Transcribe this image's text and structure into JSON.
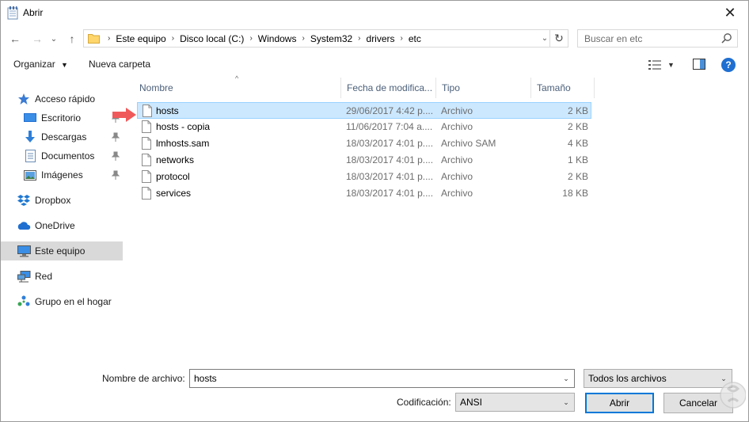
{
  "window": {
    "title": "Abrir",
    "close_glyph": "✕"
  },
  "nav": {
    "back_glyph": "←",
    "forward_glyph": "→",
    "recent_glyph": "⌄",
    "up_glyph": "↑",
    "breadcrumbs": [
      "Este equipo",
      "Disco local (C:)",
      "Windows",
      "System32",
      "drivers",
      "etc"
    ],
    "separator": "›",
    "refresh_glyph": "↻",
    "search_placeholder": "Buscar en etc"
  },
  "commandbar": {
    "organize_label": "Organizar",
    "new_folder_label": "Nueva carpeta",
    "help_glyph": "?"
  },
  "sidebar": {
    "items": [
      {
        "label": "Acceso rápido",
        "icon": "star-icon",
        "pinned": false
      },
      {
        "label": "Escritorio",
        "icon": "desktop-icon",
        "pinned": true
      },
      {
        "label": "Descargas",
        "icon": "download-icon",
        "pinned": true
      },
      {
        "label": "Documentos",
        "icon": "documents-icon",
        "pinned": true
      },
      {
        "label": "Imágenes",
        "icon": "pictures-icon",
        "pinned": true
      },
      {
        "label": "Dropbox",
        "icon": "dropbox-icon",
        "pinned": false
      },
      {
        "label": "OneDrive",
        "icon": "onedrive-icon",
        "pinned": false
      },
      {
        "label": "Este equipo",
        "icon": "computer-icon",
        "pinned": false,
        "selected": true
      },
      {
        "label": "Red",
        "icon": "network-icon",
        "pinned": false
      },
      {
        "label": "Grupo en el hogar",
        "icon": "homegroup-icon",
        "pinned": false
      }
    ]
  },
  "filelist": {
    "columns": [
      "Nombre",
      "Fecha de modifica...",
      "Tipo",
      "Tamaño"
    ],
    "sort_glyph": "^",
    "rows": [
      {
        "name": "hosts",
        "date": "29/06/2017 4:42 p....",
        "type": "Archivo",
        "size": "2 KB",
        "selected": true
      },
      {
        "name": "hosts - copia",
        "date": "11/06/2017 7:04 a....",
        "type": "Archivo",
        "size": "2 KB"
      },
      {
        "name": "lmhosts.sam",
        "date": "18/03/2017 4:01 p....",
        "type": "Archivo SAM",
        "size": "4 KB"
      },
      {
        "name": "networks",
        "date": "18/03/2017 4:01 p....",
        "type": "Archivo",
        "size": "1 KB"
      },
      {
        "name": "protocol",
        "date": "18/03/2017 4:01 p....",
        "type": "Archivo",
        "size": "2 KB"
      },
      {
        "name": "services",
        "date": "18/03/2017 4:01 p....",
        "type": "Archivo",
        "size": "18 KB"
      }
    ]
  },
  "footer": {
    "filename_label": "Nombre de archivo:",
    "filename_value": "hosts",
    "filter_value": "Todos los archivos",
    "encoding_label": "Codificación:",
    "encoding_value": "ANSI",
    "open_label": "Abrir",
    "cancel_label": "Cancelar",
    "dropdown_glyph": "⌄"
  },
  "colors": {
    "selection": "#cce8ff",
    "selection_border": "#99d1ff",
    "accent": "#0078d7",
    "arrow": "#f0595a"
  }
}
